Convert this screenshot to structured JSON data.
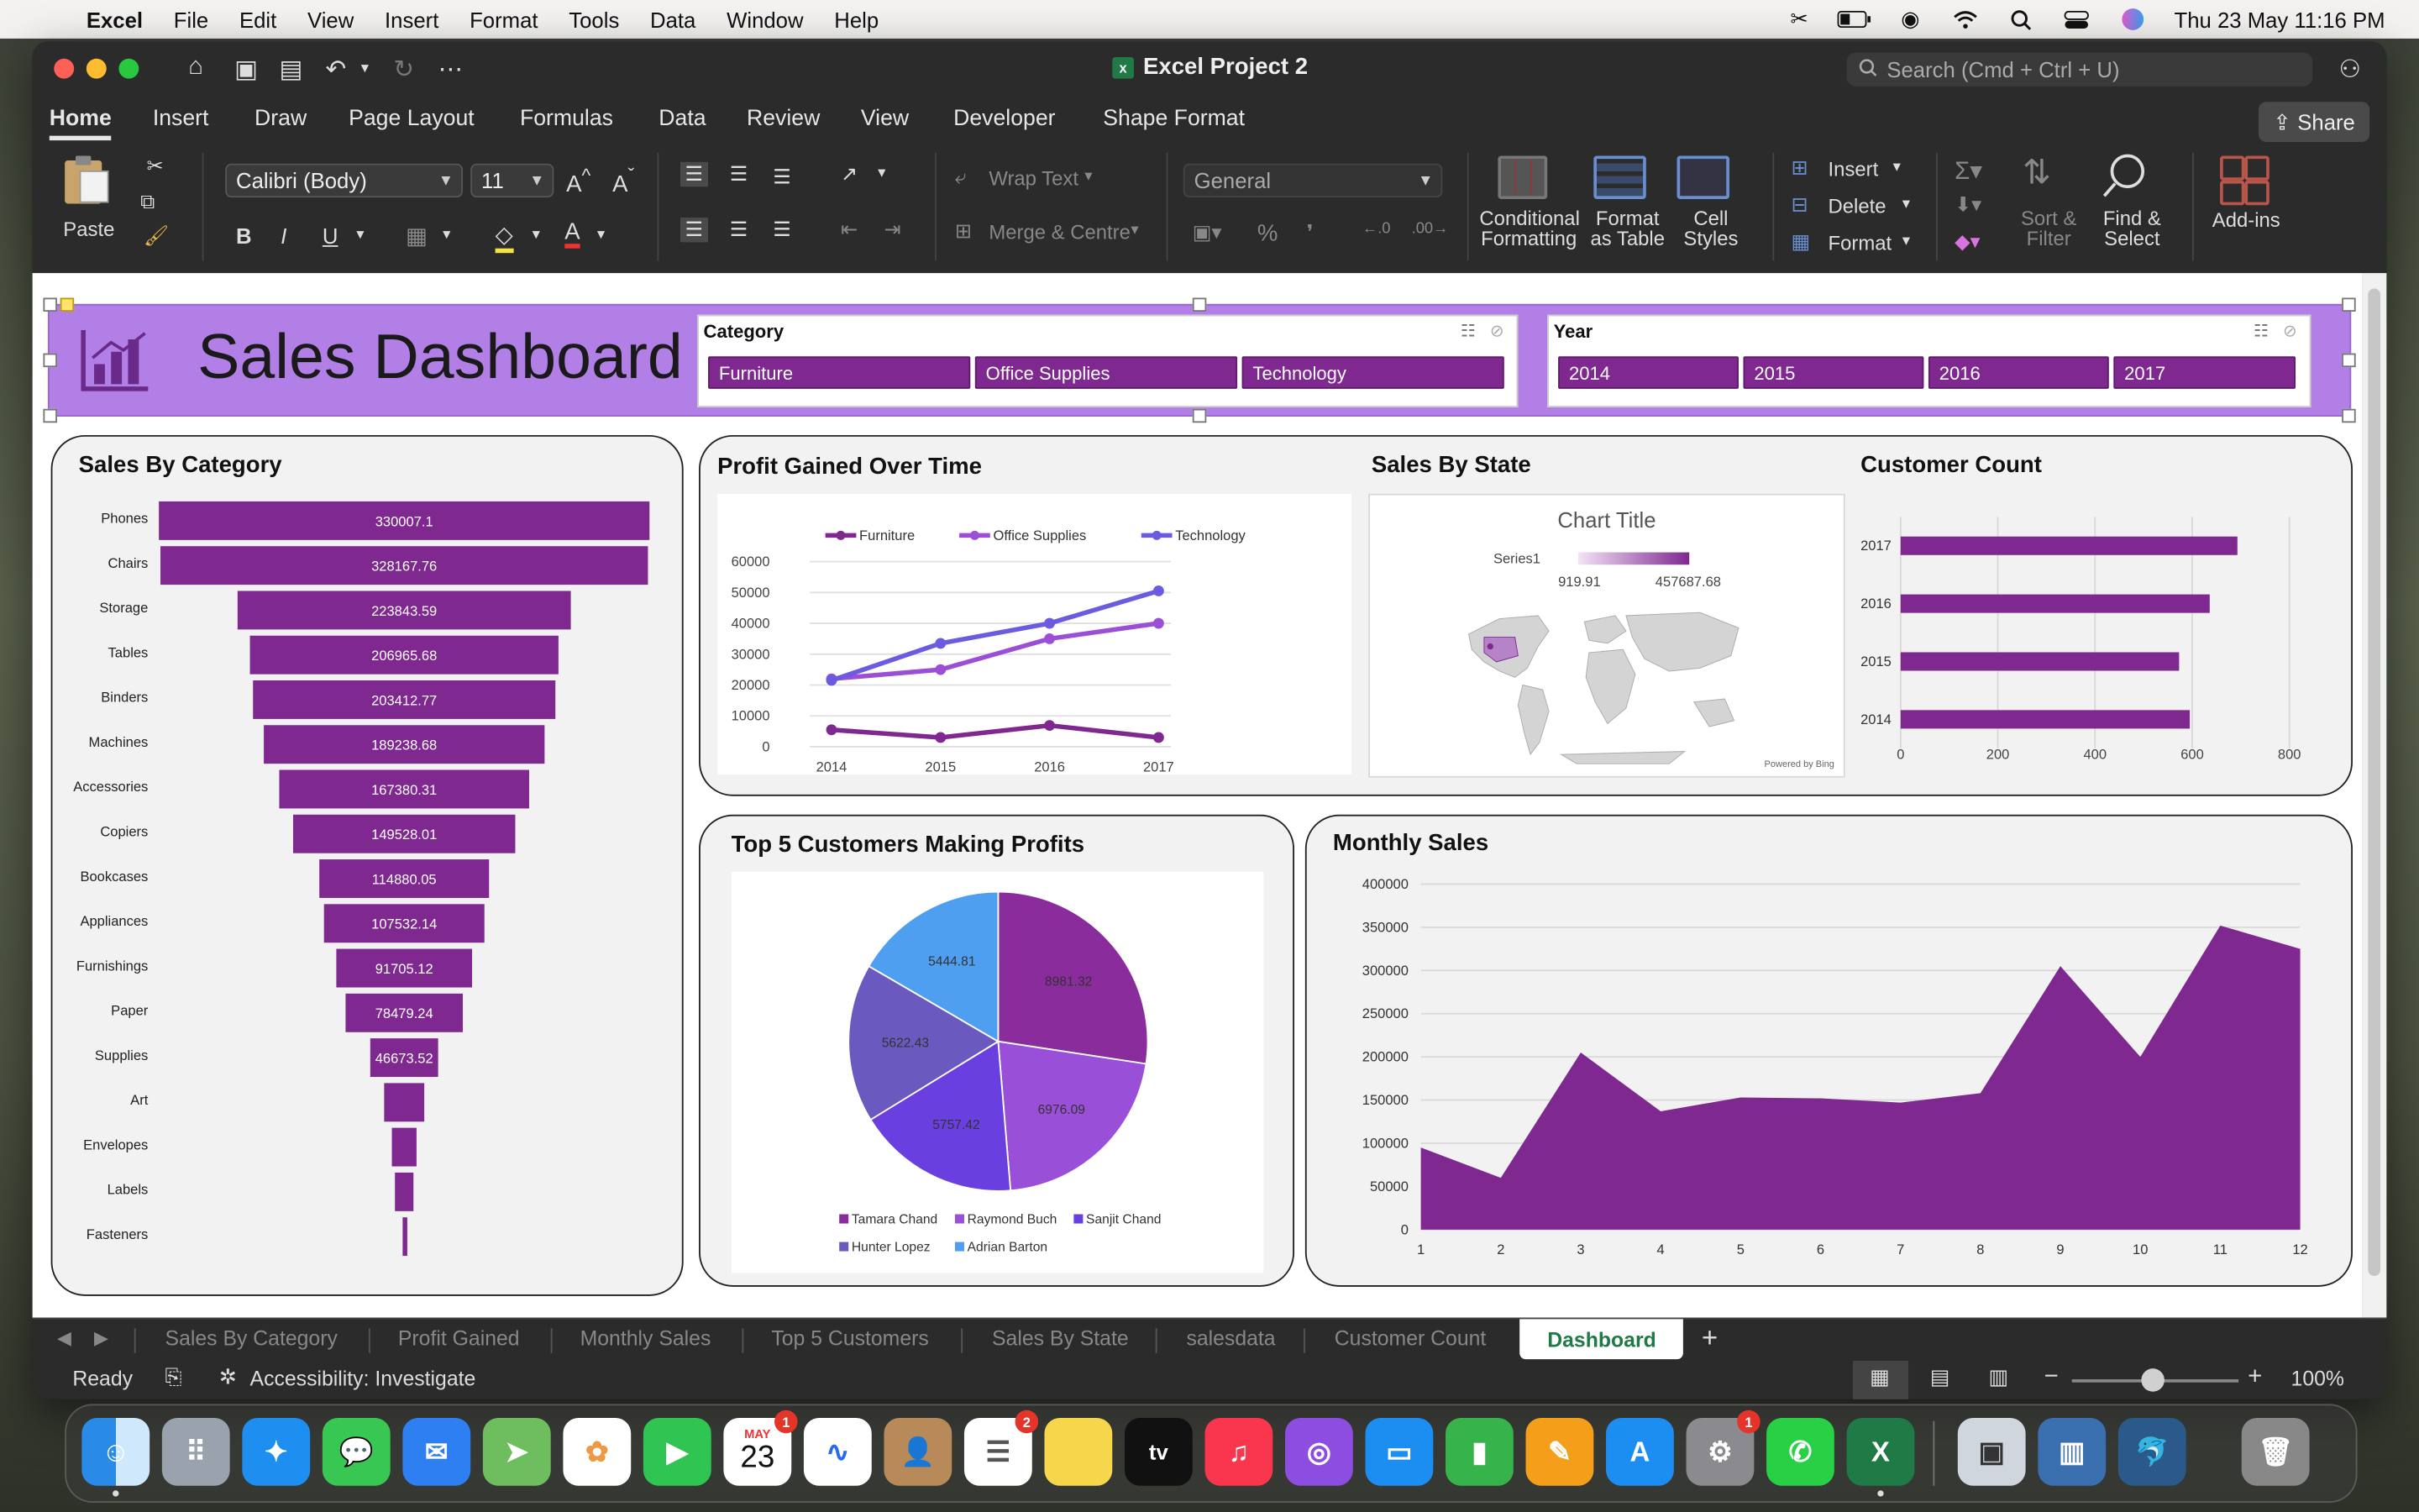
{
  "menubar": {
    "app": "Excel",
    "items": [
      "File",
      "Edit",
      "View",
      "Insert",
      "Format",
      "Tools",
      "Data",
      "Window",
      "Help"
    ],
    "clock": "Thu 23 May  11:16 PM"
  },
  "window": {
    "title": "Excel Project 2",
    "search_placeholder": "Search (Cmd + Ctrl + U)",
    "share_label": "Share"
  },
  "ribbon": {
    "tabs": [
      "Home",
      "Insert",
      "Draw",
      "Page Layout",
      "Formulas",
      "Data",
      "Review",
      "View",
      "Developer",
      "Shape Format"
    ],
    "paste": "Paste",
    "font_name": "Calibri (Body)",
    "font_size": "11",
    "wrap_text": "Wrap Text",
    "merge_centre": "Merge & Centre",
    "number_format": "General",
    "conditional_formatting": "Conditional Formatting",
    "format_as_table": "Format as Table",
    "cell_styles": "Cell Styles",
    "insert": "Insert",
    "delete": "Delete",
    "format": "Format",
    "sort_filter": "Sort & Filter",
    "find_select": "Find & Select",
    "addins": "Add-ins"
  },
  "dashboard": {
    "title": "Sales Dashboard",
    "category_slicer": {
      "header": "Category",
      "items": [
        "Furniture",
        "Office Supplies",
        "Technology"
      ]
    },
    "year_slicer": {
      "header": "Year",
      "items": [
        "2014",
        "2015",
        "2016",
        "2017"
      ]
    },
    "sales_by_category_title": "Sales By Category",
    "profit_title": "Profit Gained Over Time",
    "state_title": "Sales By State",
    "customer_count_title": "Customer Count",
    "top5_title": "Top 5 Customers Making Profits",
    "monthly_title": "Monthly Sales",
    "map": {
      "chart_title": "Chart Title",
      "series": "Series1",
      "min": "919.91",
      "max": "457687.68",
      "credit": "Powered by Bing"
    }
  },
  "chart_data": [
    {
      "type": "bar",
      "name": "Sales By Category",
      "categories": [
        "Phones",
        "Chairs",
        "Storage",
        "Tables",
        "Binders",
        "Machines",
        "Accessories",
        "Copiers",
        "Bookcases",
        "Appliances",
        "Furnishings",
        "Paper",
        "Supplies",
        "Art",
        "Envelopes",
        "Labels",
        "Fasteners"
      ],
      "values": [
        330007.1,
        328167.76,
        223843.59,
        206965.68,
        203412.77,
        189238.68,
        167380.31,
        149528.01,
        114880.05,
        107532.14,
        91705.12,
        78479.24,
        46673.52,
        27119,
        16476,
        12486,
        3024
      ],
      "labels": [
        "330007.1",
        "328167.76",
        "223843.59",
        "206965.68",
        "203412.77",
        "189238.68",
        "167380.31",
        "149528.01",
        "114880.05",
        "107532.14",
        "91705.12",
        "78479.24",
        "46673.52",
        "",
        "",
        "",
        ""
      ]
    },
    {
      "type": "line",
      "name": "Profit Gained Over Time",
      "x": [
        "2014",
        "2015",
        "2016",
        "2017"
      ],
      "ylim": [
        0,
        60000
      ],
      "yticks": [
        "0",
        "10000",
        "20000",
        "30000",
        "40000",
        "50000",
        "60000"
      ],
      "series": [
        {
          "name": "Furniture",
          "values": [
            5500,
            3000,
            6900,
            3000
          ],
          "color": "#7e2890"
        },
        {
          "name": "Office Supplies",
          "values": [
            22000,
            25000,
            35000,
            40000
          ],
          "color": "#9b4fd6"
        },
        {
          "name": "Technology",
          "values": [
            21500,
            33500,
            40000,
            50500
          ],
          "color": "#6a5be0"
        }
      ]
    },
    {
      "type": "bar",
      "name": "Customer Count",
      "categories": [
        "2017",
        "2016",
        "2015",
        "2014"
      ],
      "values": [
        693,
        636,
        573,
        595
      ],
      "xlim": [
        0,
        800
      ],
      "xticks": [
        "0",
        "200",
        "400",
        "600",
        "800"
      ]
    },
    {
      "type": "pie",
      "name": "Top 5 Customers Making Profits",
      "categories": [
        "Tamara Chand",
        "Raymond Buch",
        "Sanjit Chand",
        "Hunter Lopez",
        "Adrian Barton"
      ],
      "values": [
        8981.32,
        6976.09,
        5757.42,
        5622.43,
        5444.81
      ],
      "labels": [
        "8981.32",
        "6976.09",
        "5757.42",
        "5622.43",
        "5444.81"
      ],
      "colors": [
        "#8a2c9c",
        "#9a4fd8",
        "#6a3fe0",
        "#6a5abf",
        "#4f9ff0"
      ]
    },
    {
      "type": "area",
      "name": "Monthly Sales",
      "x": [
        "1",
        "2",
        "3",
        "4",
        "5",
        "6",
        "7",
        "8",
        "9",
        "10",
        "11",
        "12"
      ],
      "values": [
        95000,
        60000,
        205000,
        137000,
        153000,
        152000,
        147000,
        158000,
        305000,
        200000,
        352000,
        325000
      ],
      "ylim": [
        0,
        400000
      ],
      "yticks": [
        "0",
        "50000",
        "100000",
        "150000",
        "200000",
        "250000",
        "300000",
        "350000",
        "400000"
      ]
    }
  ],
  "sheet_tabs": [
    "Sales By Category",
    "Profit Gained",
    "Monthly Sales",
    "Top 5 Customers",
    "Sales By State",
    "salesdata",
    "Customer Count",
    "Dashboard"
  ],
  "status": {
    "ready": "Ready",
    "accessibility": "Accessibility: Investigate",
    "zoom": "100%"
  },
  "dock": {
    "calendar_month": "MAY",
    "calendar_day": "23",
    "calendar_badge": "1",
    "reminders_badge": "2",
    "settings_badge": "1"
  }
}
